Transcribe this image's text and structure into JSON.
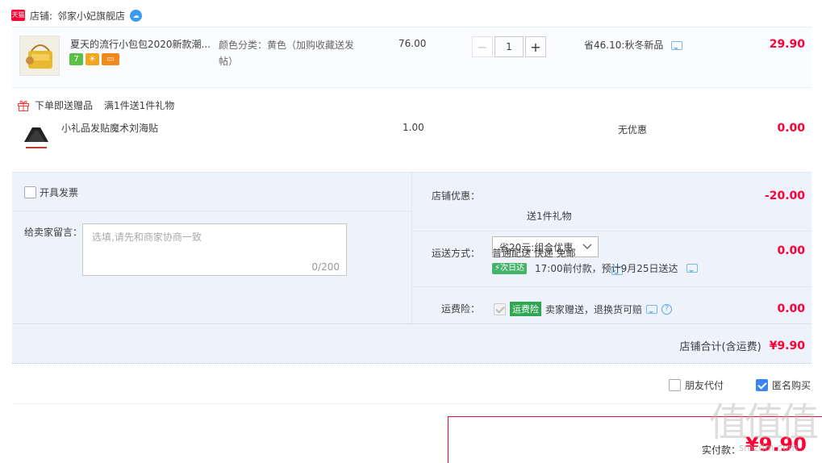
{
  "shop": {
    "tmall_label": "天猫",
    "name_label": "店铺:",
    "name": "邻家小妃旗舰店"
  },
  "item": {
    "title": "夏天的流行小包包2020新款潮...",
    "sku_label": "颜色分类：黄色（加购收藏送发",
    "sku_label_2": "帖）",
    "unit_price": "76.00",
    "quantity": "1",
    "discount_text": "省46.10:秋冬新品",
    "subtotal": "29.90",
    "service_icons": [
      "7",
      "sun-icon",
      "card-icon"
    ]
  },
  "gift": {
    "header_label": "下单即送赠品",
    "rule_label": "满1件送1件礼物",
    "title": "小礼品发贴魔术刘海贴",
    "price": "1.00",
    "discount_text": "无优惠",
    "subtotal": "0.00"
  },
  "options": {
    "invoice_label": "开具发票",
    "memo_label": "给卖家留言：",
    "memo_placeholder": "选填,请先和商家协商一致",
    "memo_counter": "0/200"
  },
  "promo": {
    "label": "店铺优惠：",
    "selected": "省20元:组合优惠",
    "gift_note": "送1件礼物",
    "amount": "-20.00"
  },
  "shipping": {
    "label": "运送方式：",
    "method": "普通配送 快递 免邮",
    "nextday_badge": "次日达",
    "eta": "17:00前付款，预计9月25日送达",
    "amount": "0.00"
  },
  "insurance": {
    "label": "运费险：",
    "badge": "运费险",
    "desc": "卖家赠送，退换货可赔",
    "amount": "0.00"
  },
  "total": {
    "label": "店铺合计(含运费)",
    "amount": "¥9.90"
  },
  "footer": {
    "friend_pay": "朋友代付",
    "anonymous": "匿名购买",
    "pay_label": "实付款：",
    "pay_amount": "¥9.90"
  },
  "watermark": {
    "text": "值值值",
    "sub": "smzdm.com"
  },
  "colors": {
    "price_red": "#ff0036",
    "panel_bg": "#eef3fb",
    "checkbox_blue": "#3e82f7"
  }
}
